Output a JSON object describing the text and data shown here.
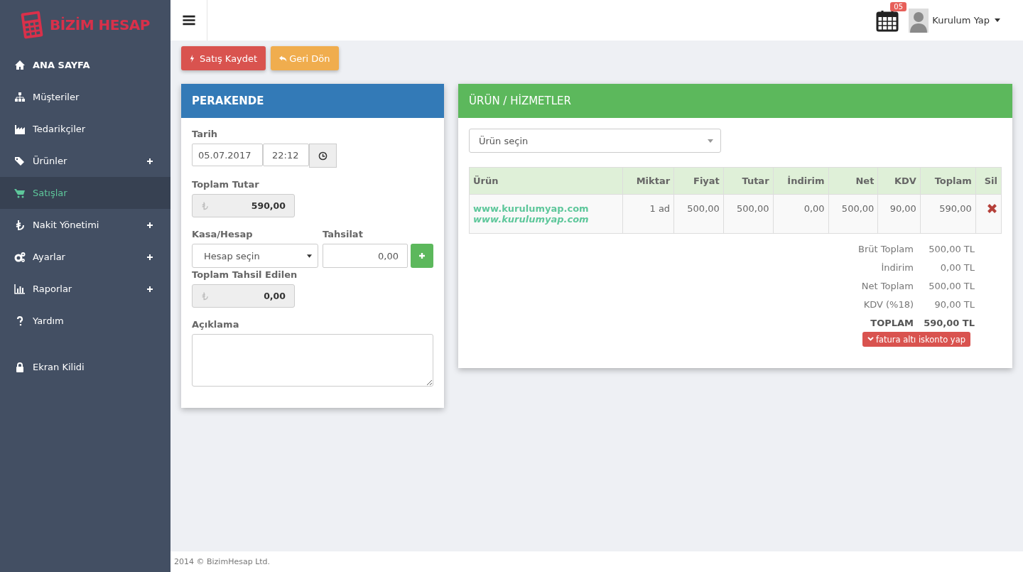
{
  "brand": {
    "name": "BİZİM HESAP"
  },
  "sidebar": {
    "items": [
      {
        "label": "ANA SAYFA",
        "selected": false,
        "expandable": false,
        "bold": true
      },
      {
        "label": "Müşteriler",
        "selected": false,
        "expandable": false,
        "bold": false
      },
      {
        "label": "Tedarikçiler",
        "selected": false,
        "expandable": false,
        "bold": false
      },
      {
        "label": "Ürünler",
        "selected": false,
        "expandable": true,
        "bold": false
      },
      {
        "label": "Satışlar",
        "selected": true,
        "expandable": false,
        "bold": false
      },
      {
        "label": "Nakit Yönetimi",
        "selected": false,
        "expandable": true,
        "bold": false
      },
      {
        "label": "Ayarlar",
        "selected": false,
        "expandable": true,
        "bold": false
      },
      {
        "label": "Raporlar",
        "selected": false,
        "expandable": true,
        "bold": false
      },
      {
        "label": "Yardım",
        "selected": false,
        "expandable": false,
        "bold": false
      },
      {
        "label": "Ekran Kilidi",
        "selected": false,
        "expandable": false,
        "bold": false
      }
    ]
  },
  "header": {
    "calendar_badge": "05",
    "user": "Kurulum Yap"
  },
  "actions": [
    {
      "label": "Satış Kaydet",
      "kind": "save"
    },
    {
      "label": "Geri Dön",
      "kind": "back"
    }
  ],
  "left_panel": {
    "title": "PERAKENDE",
    "date_label": "Tarih",
    "date": "05.07.2017",
    "time": "22:12",
    "total_label": "Toplam Tutar",
    "total": "590,00",
    "account_label": "Kasa/Hesap",
    "account_placeholder": "Hesap seçin",
    "payment_label": "Tahsilat",
    "payment": "0,00",
    "collected_label": "Toplam Tahsil Edilen",
    "collected": "0,00",
    "note_label": "Açıklama"
  },
  "right_panel": {
    "title": "ÜRÜN / HİZMETLER",
    "product_placeholder": "Ürün seçin",
    "table": {
      "columns": [
        "Ürün",
        "Miktar",
        "Fiyat",
        "Tutar",
        "İndirim",
        "Net",
        "KDV",
        "Toplam",
        "Sil"
      ],
      "rows": [
        {
          "cells": [
            {
              "name": "www.kurulumyap.com",
              "description": "www.kurulumyap.com"
            },
            "1 ad",
            "500,00",
            "500,00",
            "0,00",
            "500,00",
            "90,00",
            "590,00"
          ]
        }
      ]
    },
    "summary": [
      {
        "label": "Brüt Toplam",
        "value": "500,00 TL",
        "kind": "line"
      },
      {
        "label": "İndirim",
        "value": "0,00 TL",
        "kind": "line"
      },
      {
        "label": "Net Toplam",
        "value": "500,00 TL",
        "kind": "line"
      },
      {
        "label": "KDV (%18)",
        "value": "90,00 TL",
        "kind": "line"
      },
      {
        "label": "TOPLAM",
        "value": "590,00 TL",
        "kind": "total"
      }
    ],
    "discount_button": "fatura altı iskonto yap"
  },
  "footer": "2014 © BizimHesap Ltd."
}
